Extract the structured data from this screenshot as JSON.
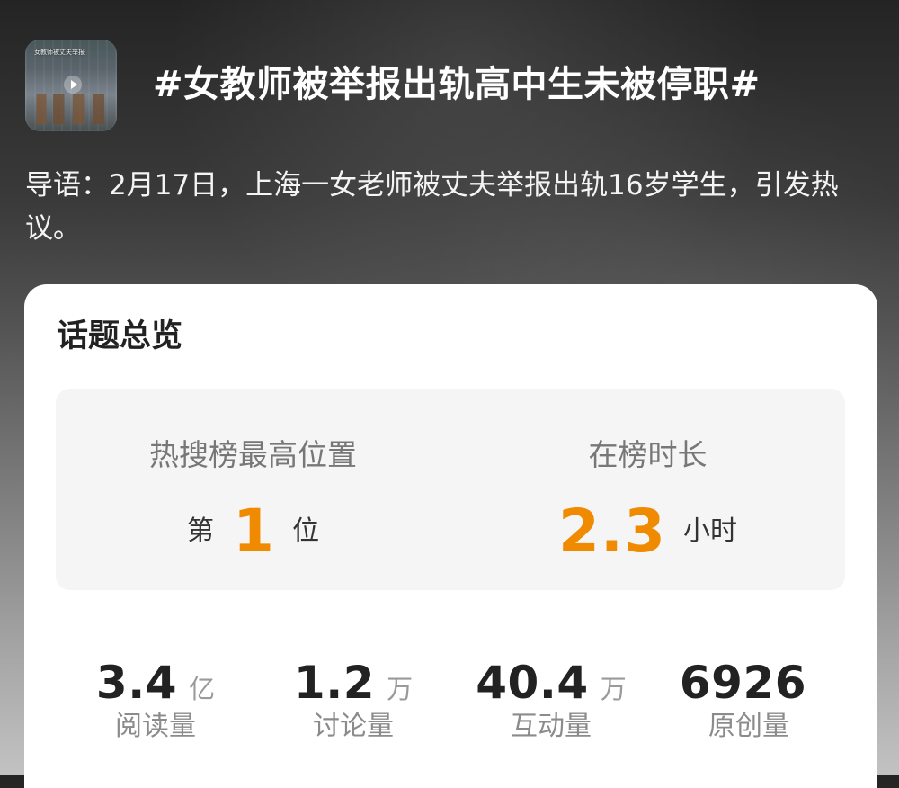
{
  "header": {
    "thumbnail": {
      "caption": "女教师被丈夫举报",
      "icon": "play-icon"
    },
    "title": "#女教师被举报出轨高中生未被停职#"
  },
  "intro": {
    "text": "导语：2月17日，上海一女老师被丈夫举报出轨16岁学生，引发热议。"
  },
  "overview": {
    "title": "话题总览",
    "highlights": {
      "rank": {
        "label": "热搜榜最高位置",
        "prefix": "第",
        "value": "1",
        "suffix": "位"
      },
      "duration": {
        "label": "在榜时长",
        "value": "2.3",
        "suffix": "小时"
      }
    },
    "stats": [
      {
        "value": "3.4",
        "unit": "亿",
        "label": "阅读量"
      },
      {
        "value": "1.2",
        "unit": "万",
        "label": "讨论量"
      },
      {
        "value": "40.4",
        "unit": "万",
        "label": "互动量"
      },
      {
        "value": "6926",
        "unit": "",
        "label": "原创量"
      }
    ]
  },
  "colors": {
    "accent": "#f08a00",
    "card_background": "#ffffff",
    "highlight_background": "#f5f5f5"
  }
}
